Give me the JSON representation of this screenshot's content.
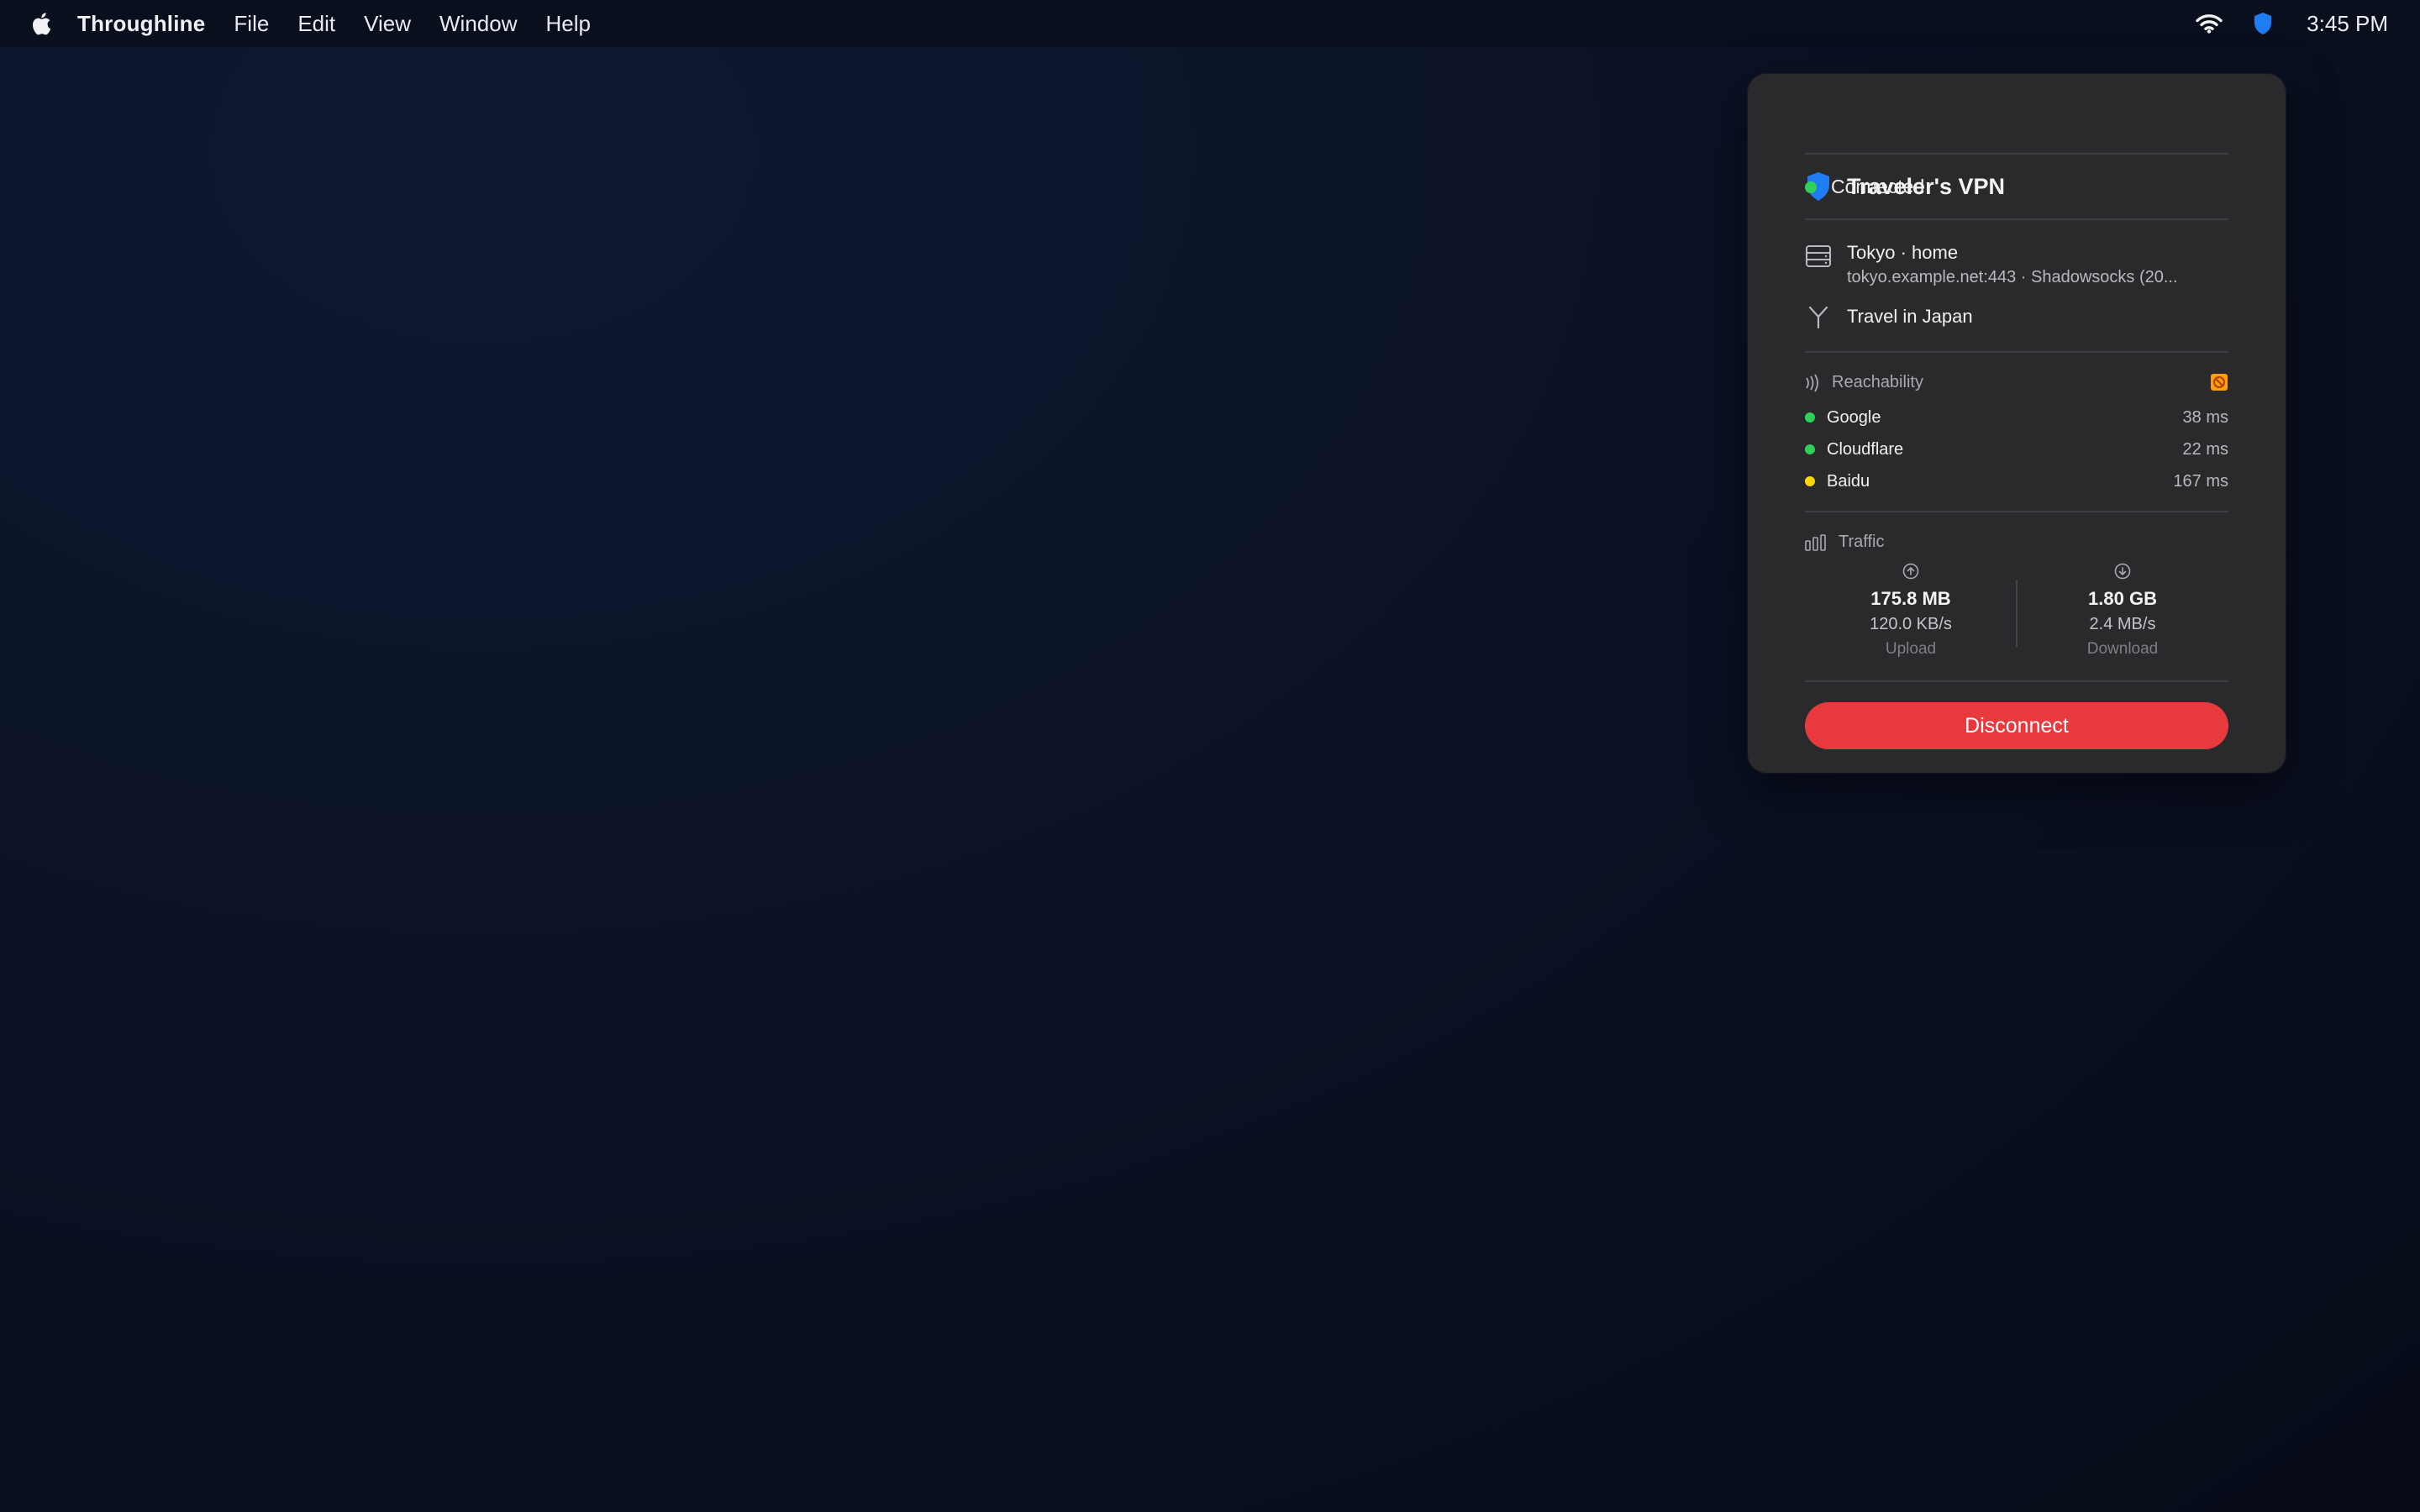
{
  "menubar": {
    "app_name": "Throughline",
    "items": [
      "File",
      "Edit",
      "View",
      "Window",
      "Help"
    ],
    "clock": "3:45 PM",
    "icons": [
      "apple-icon",
      "wifi-icon",
      "vpn-shield-icon"
    ]
  },
  "panel": {
    "title": "Traveler's VPN",
    "status": {
      "label": "Connected",
      "color": "#30d158"
    },
    "server": {
      "name": "Tokyo · home",
      "detail": "tokyo.example.net:443 · Shadowsocks (20..."
    },
    "route": {
      "label": "Travel in Japan"
    },
    "reachability": {
      "title": "Reachability",
      "items": [
        {
          "name": "Google",
          "latency": "38 ms",
          "color": "#30d158"
        },
        {
          "name": "Cloudflare",
          "latency": "22 ms",
          "color": "#30d158"
        },
        {
          "name": "Baidu",
          "latency": "167 ms",
          "color": "#ffd60a"
        }
      ]
    },
    "traffic": {
      "title": "Traffic",
      "upload": {
        "total": "175.8 MB",
        "rate": "120.0 KB/s",
        "label": "Upload"
      },
      "download": {
        "total": "1.80 GB",
        "rate": "2.4 MB/s",
        "label": "Download"
      }
    },
    "disconnect_label": "Disconnect"
  },
  "colors": {
    "accent_blue": "#1f7cf2",
    "danger_red": "#e8393f",
    "warning_orange": "#ff9f0a"
  }
}
